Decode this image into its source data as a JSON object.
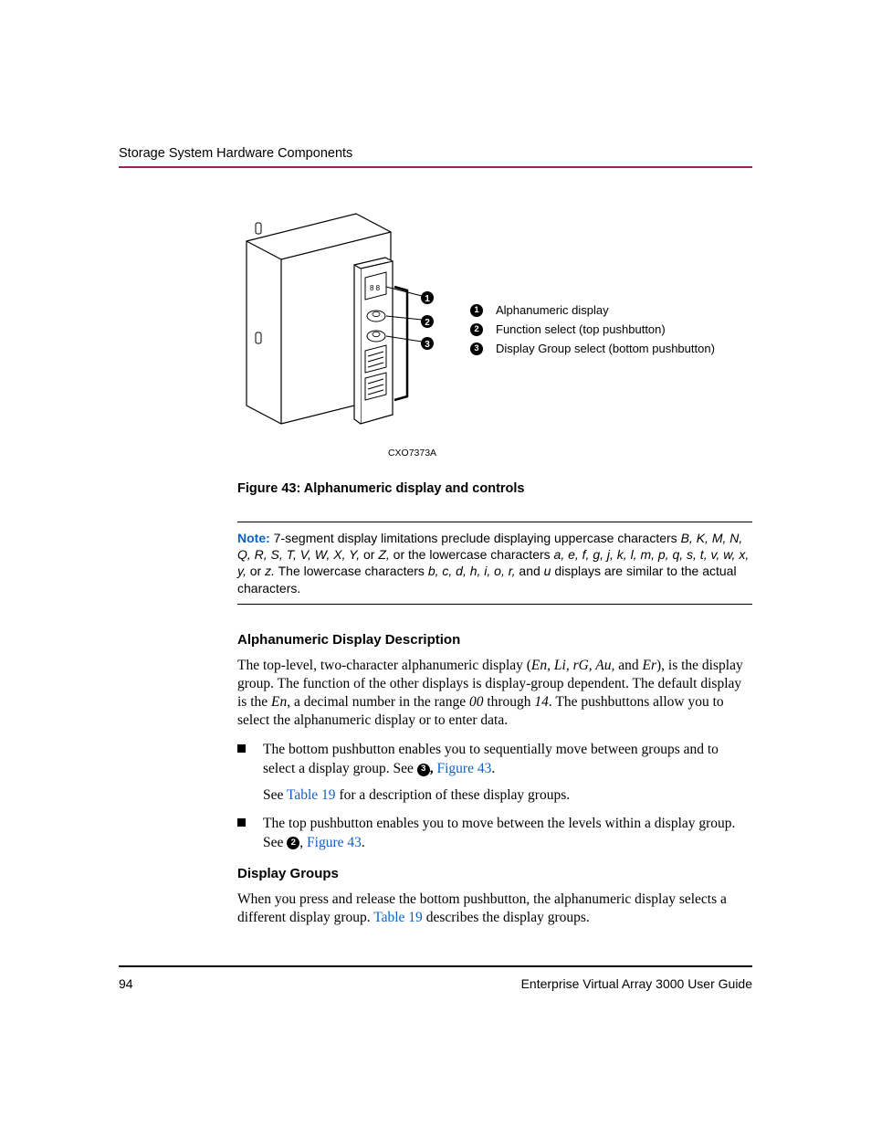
{
  "header": "Storage System Hardware Components",
  "diagram": {
    "code": "CXO7373A",
    "callouts": [
      {
        "num": "1",
        "text": "Alphanumeric display"
      },
      {
        "num": "2",
        "text": "Function select (top pushbutton)"
      },
      {
        "num": "3",
        "text": "Display Group select (bottom pushbutton)"
      }
    ]
  },
  "figure_caption": "Figure 43:  Alphanumeric display and controls",
  "note": {
    "label": "Note:",
    "pre": "  7-segment display limitations preclude displaying uppercase characters ",
    "uc": "B, K, M, N, Q, R, S, T, V, W, X, Y,",
    "mid1": " or ",
    "z": "Z,",
    "mid2": " or the lowercase characters ",
    "lc": "a, e, f, g, j, k, l, m, p, q, s, t, v, w, x, y,",
    "mid3": " or ",
    "z2": "z.",
    "mid4": " The lowercase characters ",
    "lc2": "b, c, d, h, i, o, r,",
    "mid5": " and ",
    "u": "u",
    "tail": " displays are similar to the actual characters."
  },
  "subheading1": "Alphanumeric Display Description",
  "para1": {
    "a": "The top-level, two-character alphanumeric display (",
    "codes": "En, Li, rG, Au,",
    "b": " and ",
    "er": "Er",
    "c": "), is the display group. The function of the other displays is display-group dependent. The default display is the ",
    "en": "En",
    "d": ", a decimal number in the range ",
    "r0": "00",
    "e": " through ",
    "r1": "14",
    "f": ". The pushbuttons allow you to select the alphanumeric display or to enter data."
  },
  "bullets": [
    {
      "text1": "The bottom pushbutton enables you to sequentially move between groups and to select a display group. See ",
      "circ": "3",
      "link1": "Figure 43",
      "dot": ".",
      "sub_pre": "See ",
      "sub_link": "Table 19",
      "sub_post": " for a description of these display groups."
    },
    {
      "text1": "The top pushbutton enables you to move between the levels within a display group. See ",
      "circ": "2",
      "link1": "Figure 43",
      "dot": "."
    }
  ],
  "subheading2": "Display Groups",
  "para2": {
    "a": "When you press and release the bottom pushbutton, the alphanumeric display selects a different display group. ",
    "link": "Table 19",
    "b": " describes the display groups."
  },
  "footer": {
    "page": "94",
    "title": "Enterprise Virtual Array 3000 User Guide"
  }
}
